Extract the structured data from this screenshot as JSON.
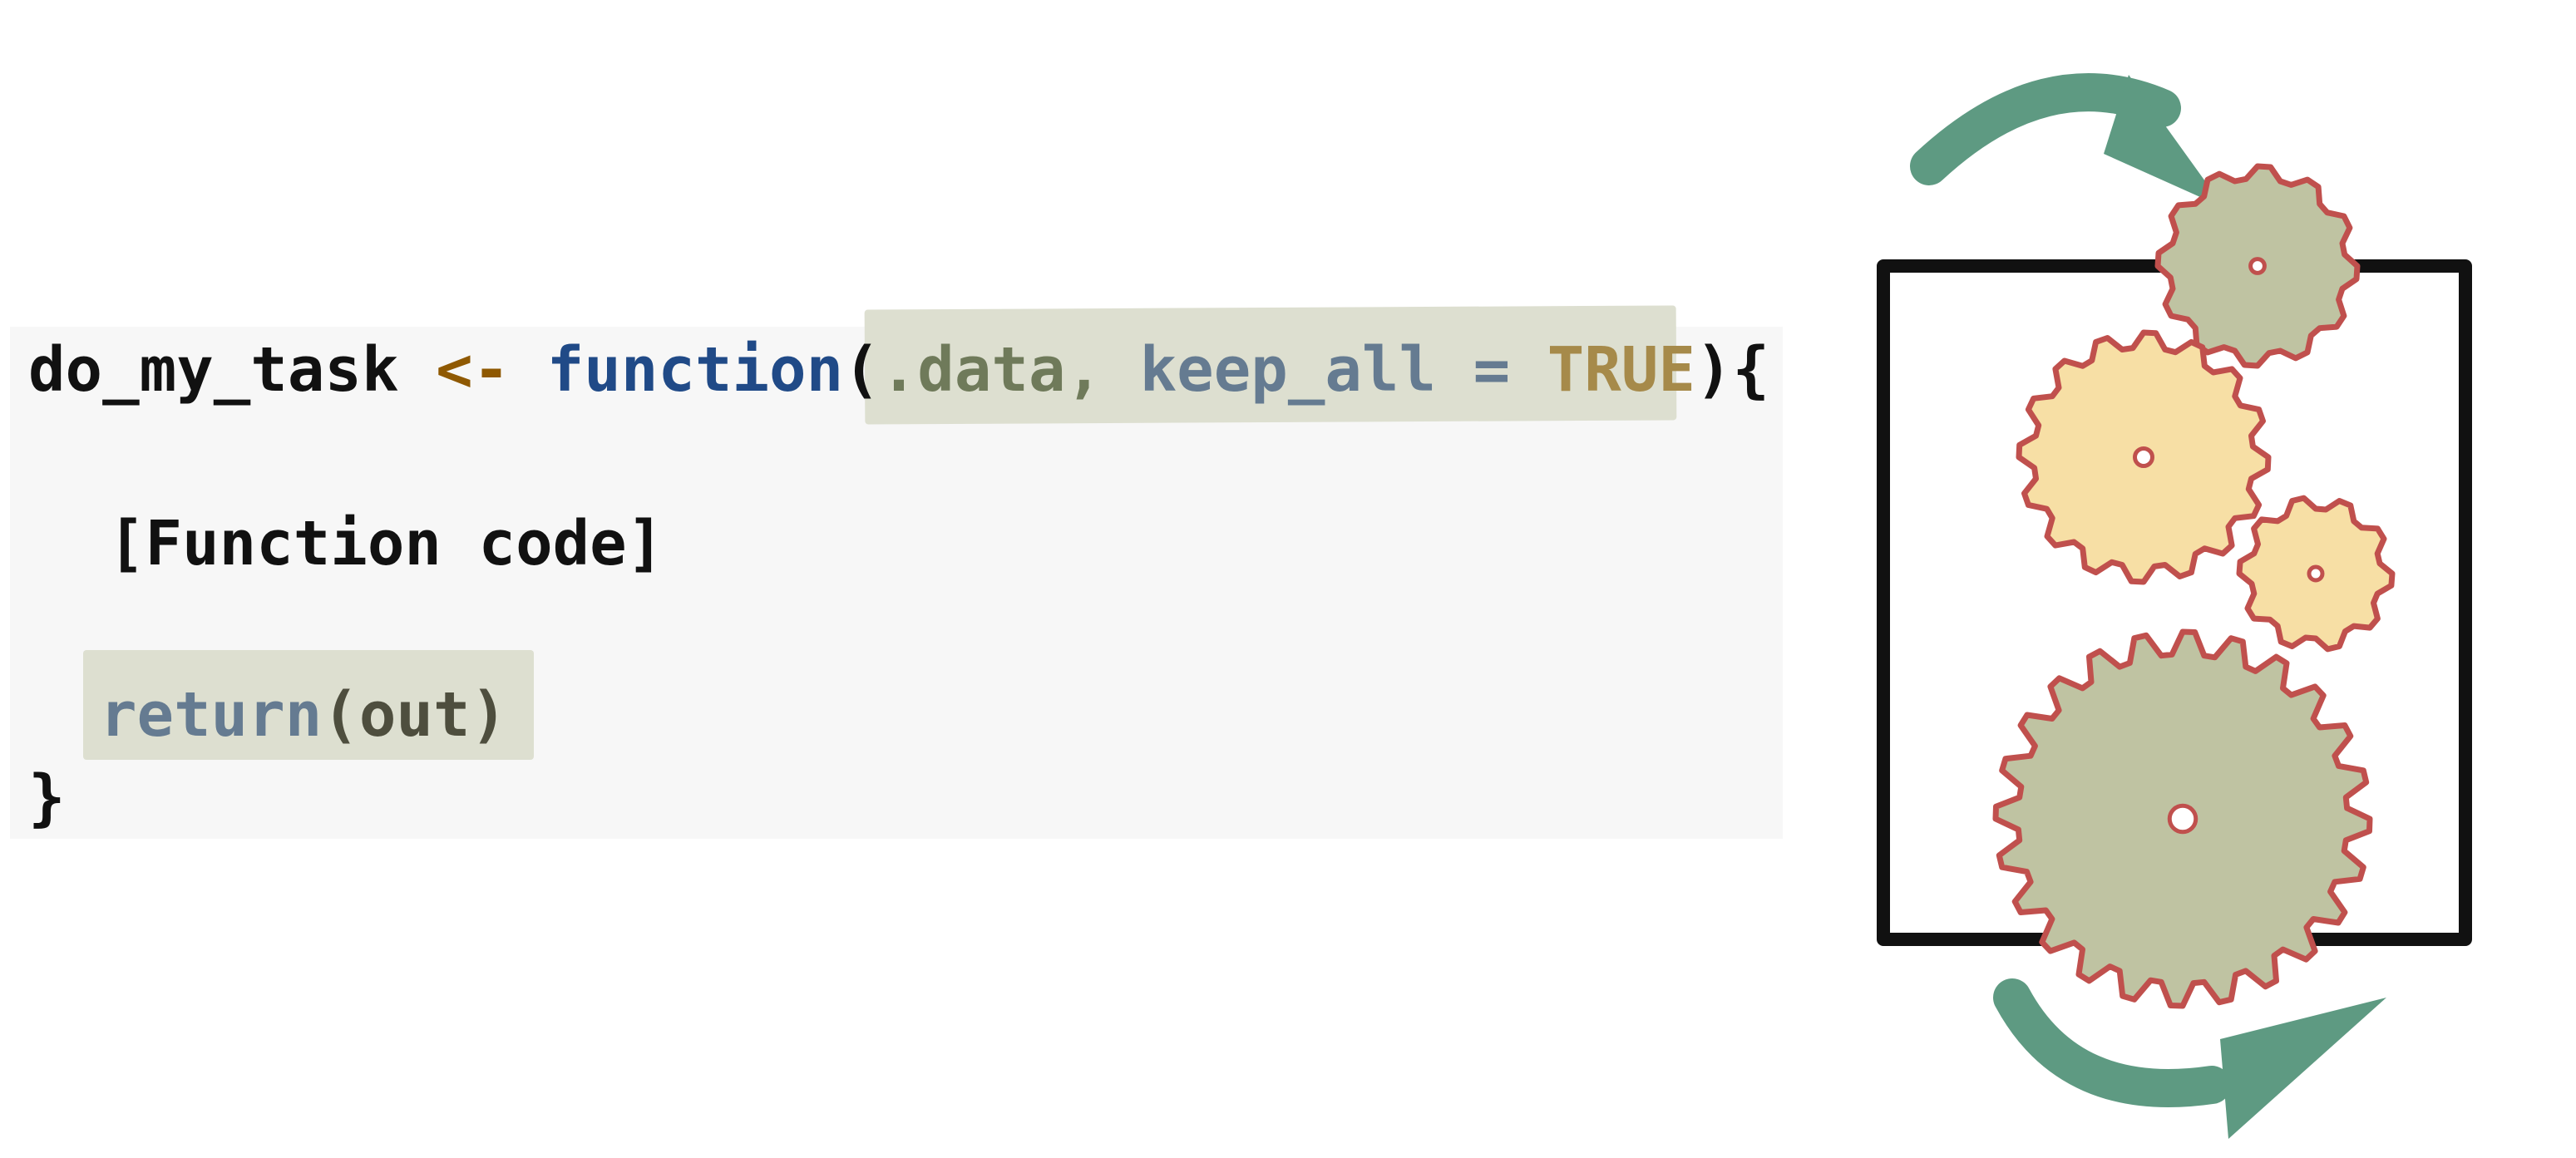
{
  "code": {
    "line1": {
      "name": "do_my_task",
      "assign": " <- ",
      "keyword": "function",
      "open_paren": "(",
      "arg_data": ".data, ",
      "arg_keep": "keep_all",
      "arg_eq": " = ",
      "arg_value": "TRUE",
      "close": "){"
    },
    "line2": "[Function code]",
    "line3": {
      "keyword": "return",
      "args": "(out)"
    },
    "line4": "}"
  },
  "illustration": {
    "icon": "gears-in-box-icon",
    "colors": {
      "arrow": "#5e9a82",
      "gear_sage": "#bfc3a2",
      "gear_yellow": "#f7dfa5",
      "gear_outline": "#c0504d",
      "box": "#111111"
    }
  }
}
